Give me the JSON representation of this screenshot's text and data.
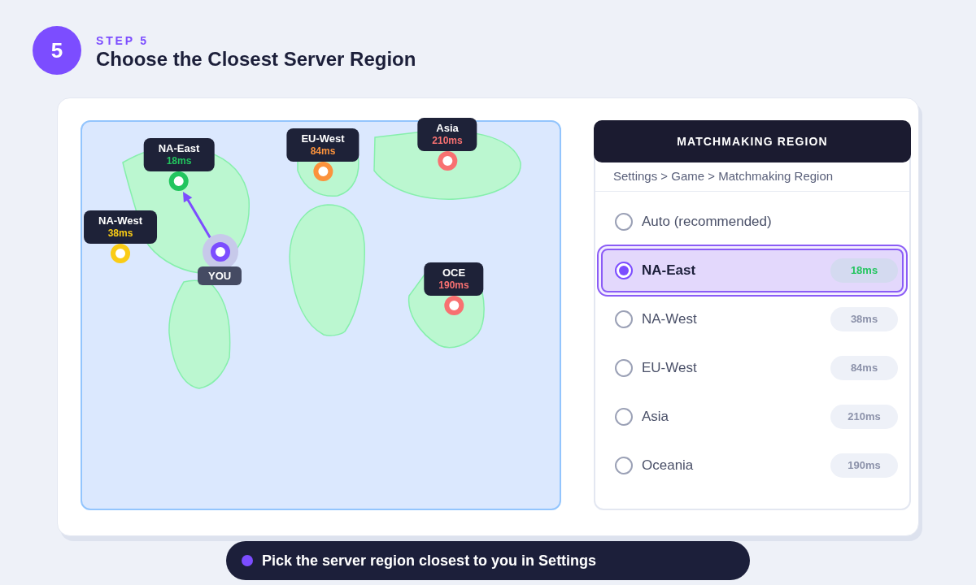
{
  "header": {
    "step_number": "5",
    "step_label": "STEP 5",
    "title": "Choose the Closest Server Region"
  },
  "map": {
    "servers": [
      {
        "name": "NA-East",
        "latency": "18ms",
        "color": "#22c55e"
      },
      {
        "name": "NA-West",
        "latency": "38ms",
        "color": "#facc15"
      },
      {
        "name": "EU-West",
        "latency": "84ms",
        "color": "#fb923c"
      },
      {
        "name": "Asia",
        "latency": "210ms",
        "color": "#f87171"
      },
      {
        "name": "OCE",
        "latency": "190ms",
        "color": "#f87171"
      }
    ],
    "you_label": "YOU"
  },
  "panel": {
    "title": "MATCHMAKING REGION",
    "breadcrumb": "Settings > Game > Matchmaking Region",
    "options": [
      {
        "label": "Auto (recommended)",
        "selected": false
      },
      {
        "label": "NA-East",
        "latency": "18ms",
        "selected": true
      },
      {
        "label": "NA-West",
        "latency": "38ms",
        "selected": false
      },
      {
        "label": "EU-West",
        "latency": "84ms",
        "selected": false
      },
      {
        "label": "Asia",
        "latency": "210ms",
        "selected": false
      },
      {
        "label": "Oceania",
        "latency": "190ms",
        "selected": false
      }
    ]
  },
  "hint": {
    "text": "Pick the server region closest to you in Settings"
  }
}
